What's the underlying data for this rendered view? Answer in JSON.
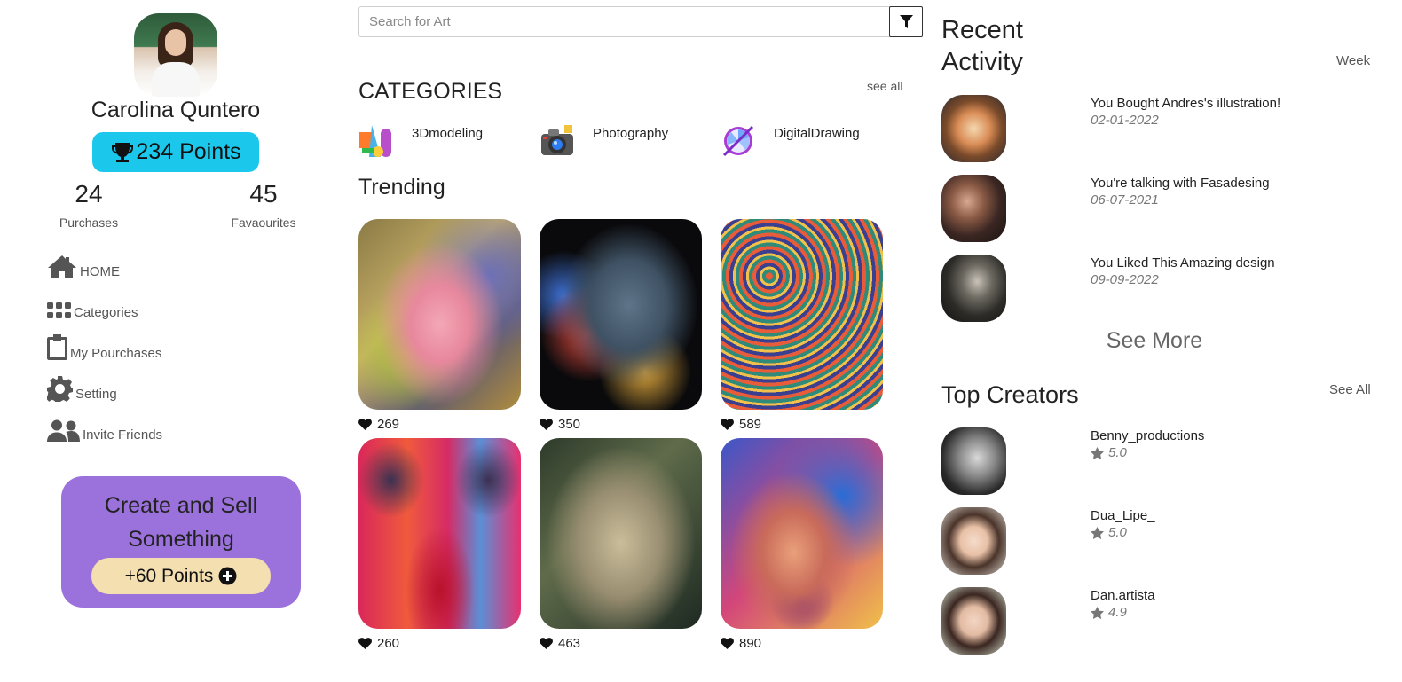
{
  "user": {
    "name": "Carolina Quntero",
    "points": "234 Points",
    "purchases_count": "24",
    "purchases_label": "Purchases",
    "favourites_count": "45",
    "favourites_label": "Favaourites"
  },
  "nav": [
    {
      "label": "HOME",
      "icon": "home-icon"
    },
    {
      "label": "Categories",
      "icon": "grid-icon"
    },
    {
      "label": "My Pourchases",
      "icon": "clipboard-icon"
    },
    {
      "label": "Setting",
      "icon": "gear-icon"
    },
    {
      "label": "Invite Friends",
      "icon": "users-icon"
    }
  ],
  "promo": {
    "title_line1": "Create and Sell",
    "title_line2": "Something",
    "button": "+60 Points"
  },
  "search": {
    "placeholder": "Search for Art"
  },
  "categories": {
    "title": "CATEGORIES",
    "see_all": "see all",
    "items": [
      {
        "label": "3Dmodeling",
        "icon": "3d-shapes-icon"
      },
      {
        "label": "Photography",
        "icon": "camera-icon"
      },
      {
        "label": "DigitalDrawing",
        "icon": "drawing-disc-icon"
      }
    ]
  },
  "trending": {
    "title": "Trending",
    "items": [
      {
        "likes": "269"
      },
      {
        "likes": "350"
      },
      {
        "likes": "589"
      },
      {
        "likes": "260"
      },
      {
        "likes": "463"
      },
      {
        "likes": "890"
      }
    ]
  },
  "recent": {
    "title": "Recent Activity",
    "period": "Week",
    "items": [
      {
        "text": "You Bought Andres's illustration!",
        "date": "02-01-2022"
      },
      {
        "text": "You're talking with Fasadesing",
        "date": "06-07-2021"
      },
      {
        "text": "You Liked This Amazing design",
        "date": "09-09-2022"
      }
    ],
    "see_more": "See More"
  },
  "creators": {
    "title": "Top Creators",
    "see_all": "See All",
    "items": [
      {
        "name": "Benny_productions",
        "rating": "5.0"
      },
      {
        "name": "Dua_Lipe_",
        "rating": "5.0"
      },
      {
        "name": "Dan.artista",
        "rating": "4.9"
      }
    ]
  },
  "colors": {
    "points_badge": "#1bc8ec",
    "promo_card": "#9b71dc",
    "promo_button": "#f4dfb1"
  }
}
